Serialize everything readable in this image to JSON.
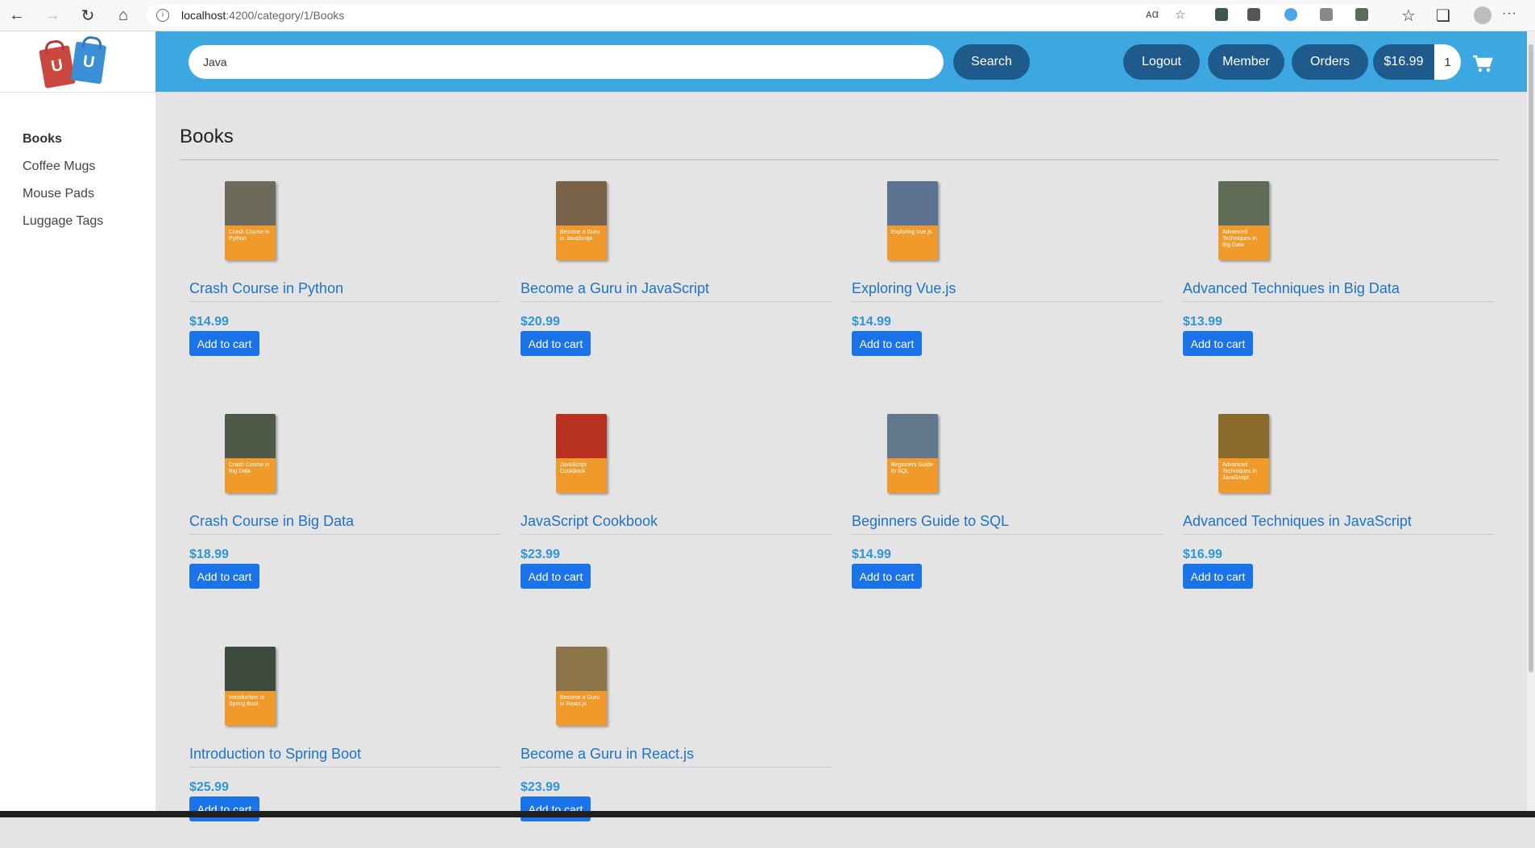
{
  "browser": {
    "url_host": "localhost",
    "url_rest": ":4200/category/1/Books"
  },
  "sidebar": {
    "categories": [
      {
        "label": "Books",
        "active": true
      },
      {
        "label": "Coffee Mugs",
        "active": false
      },
      {
        "label": "Mouse Pads",
        "active": false
      },
      {
        "label": "Luggage Tags",
        "active": false
      }
    ]
  },
  "header": {
    "search_value": "Java",
    "search_label": "Search",
    "logout_label": "Logout",
    "member_label": "Member",
    "orders_label": "Orders",
    "cart_total": "$16.99",
    "cart_qty": "1"
  },
  "main": {
    "title": "Books",
    "add_to_cart_label": "Add to cart",
    "products": [
      {
        "title": "Crash Course in Python",
        "price": "$14.99",
        "cover_text": "Crash Course in Python",
        "cover_color": "#6d6a5c"
      },
      {
        "title": "Become a Guru in JavaScript",
        "price": "$20.99",
        "cover_text": "Become a Guru in JavaScript",
        "cover_color": "#7a6248"
      },
      {
        "title": "Exploring Vue.js",
        "price": "$14.99",
        "cover_text": "Exploring Vue.js",
        "cover_color": "#5b7391"
      },
      {
        "title": "Advanced Techniques in Big Data",
        "price": "$13.99",
        "cover_text": "Advanced Techniques in Big Data",
        "cover_color": "#5f6b55"
      },
      {
        "title": "Crash Course in Big Data",
        "price": "$18.99",
        "cover_text": "Crash Course in Big Data",
        "cover_color": "#4e5a47"
      },
      {
        "title": "JavaScript Cookbook",
        "price": "$23.99",
        "cover_text": "JavaScript Cookbook",
        "cover_color": "#b8321f"
      },
      {
        "title": "Beginners Guide to SQL",
        "price": "$14.99",
        "cover_text": "Beginners Guide to SQL",
        "cover_color": "#62788d"
      },
      {
        "title": "Advanced Techniques in JavaScript",
        "price": "$16.99",
        "cover_text": "Advanced Techniques in JavaScript",
        "cover_color": "#8a6a2a"
      },
      {
        "title": "Introduction to Spring Boot",
        "price": "$25.99",
        "cover_text": "Introduction to Spring Boot",
        "cover_color": "#3c4a3e"
      },
      {
        "title": "Become a Guru in React.js",
        "price": "$23.99",
        "cover_text": "Become a Guru in React.js",
        "cover_color": "#8a7448"
      }
    ]
  }
}
